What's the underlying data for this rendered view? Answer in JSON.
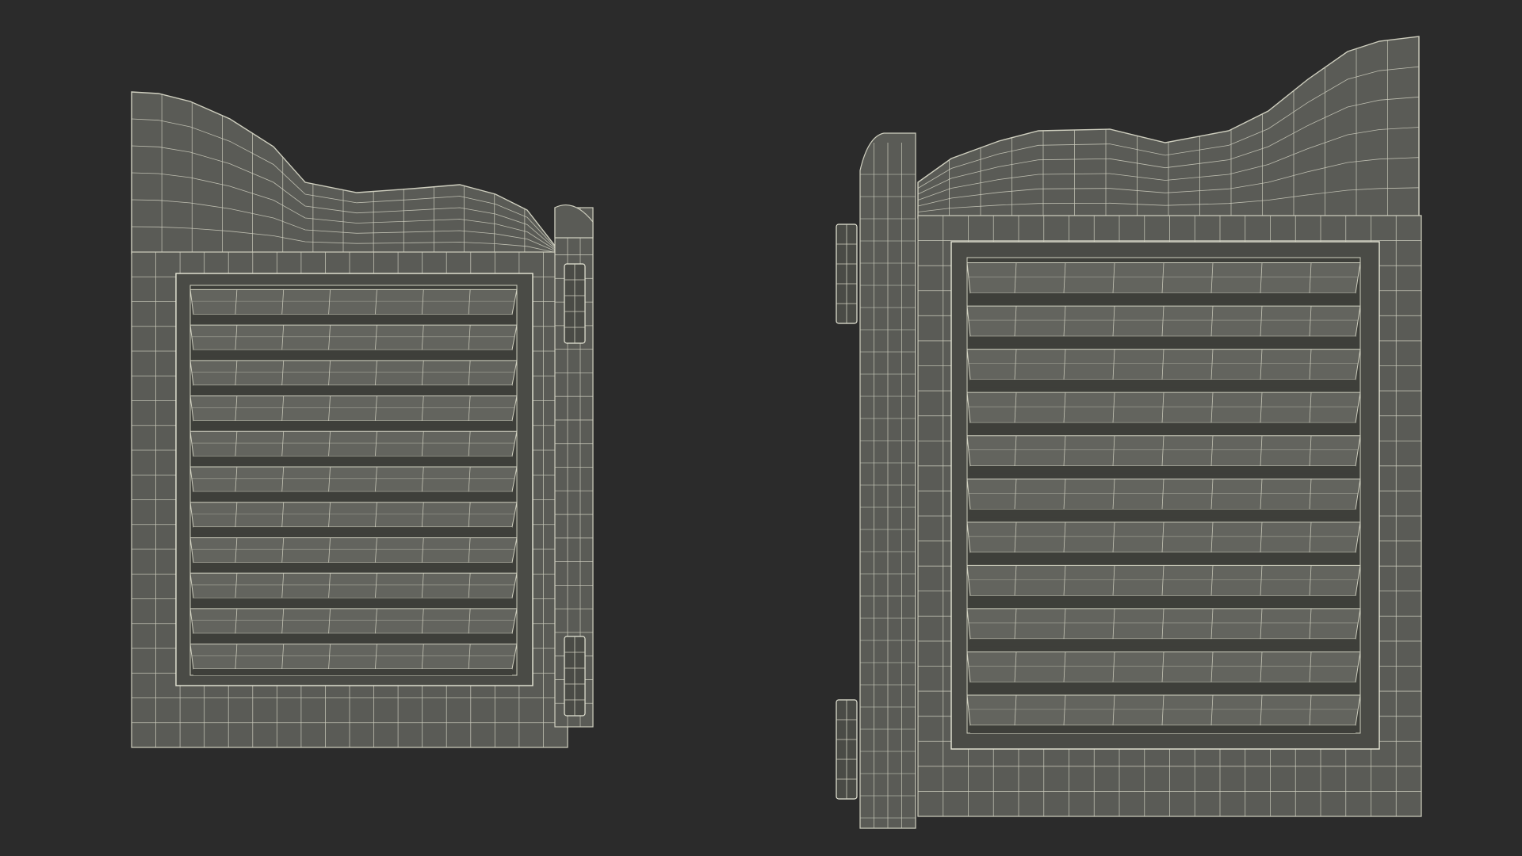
{
  "scene": {
    "background_color": "#2b2b2b",
    "panel_fill": "#5a5b56",
    "panel_fill_dark": "#4a4b46",
    "slat_fill": "#63645e",
    "slat_shadow": "#3e3f3a",
    "wire_color": "#cfcfbf",
    "wire_color_bright": "#e8e8d8",
    "render_style": "wireframe-on-shaded",
    "objects": [
      {
        "name": "left-saloon-door",
        "view": "angled",
        "louver_count": 11
      },
      {
        "name": "right-saloon-door",
        "view": "angled",
        "louver_count": 11
      }
    ]
  }
}
